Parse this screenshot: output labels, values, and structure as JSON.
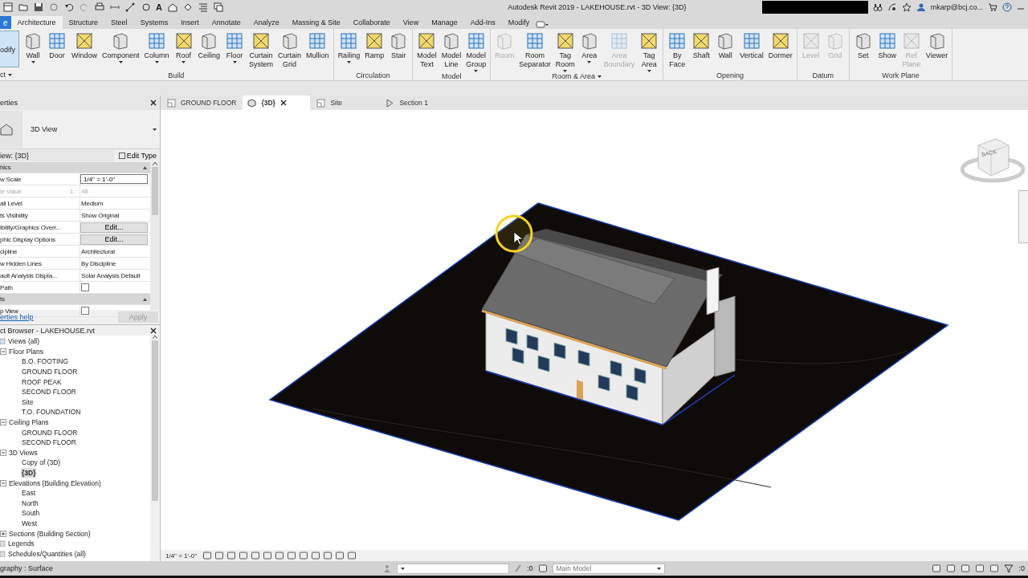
{
  "title_bar": {
    "title": "Autodesk Revit 2019 - LAKEHOUSE.rvt - 3D View: {3D}",
    "text_tool": "A",
    "user": "mkarp@bcj.co..."
  },
  "ribbon": {
    "file_tab": "e",
    "modify_label": "odify",
    "select_label": "ct",
    "tabs": [
      {
        "label": "Architecture",
        "selected": true
      },
      {
        "label": "Structure",
        "selected": false
      },
      {
        "label": "Steel",
        "selected": false
      },
      {
        "label": "Systems",
        "selected": false
      },
      {
        "label": "Insert",
        "selected": false
      },
      {
        "label": "Annotate",
        "selected": false
      },
      {
        "label": "Analyze",
        "selected": false
      },
      {
        "label": "Massing & Site",
        "selected": false
      },
      {
        "label": "Collaborate",
        "selected": false
      },
      {
        "label": "View",
        "selected": false
      },
      {
        "label": "Manage",
        "selected": false
      },
      {
        "label": "Add-Ins",
        "selected": false
      },
      {
        "label": "Modify",
        "selected": false
      }
    ],
    "groups": [
      {
        "label": "Build",
        "dropdown": false,
        "tools": [
          {
            "label": "Wall",
            "disabled": false,
            "dropdown": true
          },
          {
            "label": "Door",
            "disabled": false,
            "dropdown": false
          },
          {
            "label": "Window",
            "disabled": false,
            "dropdown": false
          },
          {
            "label": "Component",
            "disabled": false,
            "dropdown": true
          },
          {
            "label": "Column",
            "disabled": false,
            "dropdown": true
          },
          {
            "label": "Roof",
            "disabled": false,
            "dropdown": true
          },
          {
            "label": "Ceiling",
            "disabled": false,
            "dropdown": false
          },
          {
            "label": "Floor",
            "disabled": false,
            "dropdown": true
          },
          {
            "label": "Curtain System",
            "disabled": false,
            "dropdown": false
          },
          {
            "label": "Curtain Grid",
            "disabled": false,
            "dropdown": false
          },
          {
            "label": "Mullion",
            "disabled": false,
            "dropdown": false
          }
        ]
      },
      {
        "label": "Circulation",
        "dropdown": false,
        "tools": [
          {
            "label": "Railing",
            "disabled": false,
            "dropdown": true
          },
          {
            "label": "Ramp",
            "disabled": false,
            "dropdown": false
          },
          {
            "label": "Stair",
            "disabled": false,
            "dropdown": false
          }
        ]
      },
      {
        "label": "Model",
        "dropdown": false,
        "tools": [
          {
            "label": "Model Text",
            "disabled": false,
            "dropdown": false
          },
          {
            "label": "Model Line",
            "disabled": false,
            "dropdown": false
          },
          {
            "label": "Model Group",
            "disabled": false,
            "dropdown": true
          }
        ]
      },
      {
        "label": "Room & Area",
        "dropdown": true,
        "tools": [
          {
            "label": "Room",
            "disabled": true,
            "dropdown": false
          },
          {
            "label": "Room Separator",
            "disabled": false,
            "dropdown": false
          },
          {
            "label": "Tag Room",
            "disabled": false,
            "dropdown": true
          },
          {
            "label": "Area",
            "disabled": false,
            "dropdown": true
          },
          {
            "label": "Area Boundary",
            "disabled": true,
            "dropdown": false
          },
          {
            "label": "Tag Area",
            "disabled": false,
            "dropdown": true
          }
        ]
      },
      {
        "label": "Opening",
        "dropdown": false,
        "tools": [
          {
            "label": "By Face",
            "disabled": false,
            "dropdown": false
          },
          {
            "label": "Shaft",
            "disabled": false,
            "dropdown": false
          },
          {
            "label": "Wall",
            "disabled": false,
            "dropdown": false
          },
          {
            "label": "Vertical",
            "disabled": false,
            "dropdown": false
          },
          {
            "label": "Dormer",
            "disabled": false,
            "dropdown": false
          }
        ]
      },
      {
        "label": "Datum",
        "dropdown": false,
        "tools": [
          {
            "label": "Level",
            "disabled": true,
            "dropdown": false
          },
          {
            "label": "Grid",
            "disabled": true,
            "dropdown": false
          }
        ]
      },
      {
        "label": "Work Plane",
        "dropdown": false,
        "tools": [
          {
            "label": "Set",
            "disabled": false,
            "dropdown": false
          },
          {
            "label": "Show",
            "disabled": false,
            "dropdown": false
          },
          {
            "label": "Ref Plane",
            "disabled": true,
            "dropdown": false
          },
          {
            "label": "Viewer",
            "disabled": false,
            "dropdown": false
          }
        ]
      }
    ]
  },
  "properties": {
    "title": "erties",
    "type_name": "3D View",
    "instance": "iew: {3D}",
    "edit_type": "Edit Type",
    "help": "erties help",
    "apply": "Apply",
    "rows": [
      {
        "kind": "section",
        "label": "hics"
      },
      {
        "kind": "field",
        "label": "w Scale",
        "value": "1/4\" = 1'-0\""
      },
      {
        "kind": "readonly",
        "label": "le Value",
        "suffix": "1:",
        "value": "48"
      },
      {
        "kind": "text",
        "label": "ail Level",
        "value": "Medium"
      },
      {
        "kind": "text",
        "label": "ts Visibility",
        "value": "Show Original"
      },
      {
        "kind": "button",
        "label": "ibility/Graphics Overr...",
        "value": "Edit..."
      },
      {
        "kind": "button",
        "label": "phic Display Options",
        "value": "Edit..."
      },
      {
        "kind": "text",
        "label": "cipline",
        "value": "Architectural"
      },
      {
        "kind": "text",
        "label": "w Hidden Lines",
        "value": "By Discipline"
      },
      {
        "kind": "text",
        "label": "ault Analysis Displa...",
        "value": "Solar Analysis Default"
      },
      {
        "kind": "checkbox",
        "label": " Path",
        "checked": false
      },
      {
        "kind": "section",
        "label": "ts"
      },
      {
        "kind": "checkbox",
        "label": "p View",
        "checked": false
      }
    ]
  },
  "browser": {
    "title": "ct Browser - LAKEHOUSE.rvt",
    "tree": [
      {
        "label": "Views (all)",
        "selected": false,
        "expanded": true,
        "children": [
          {
            "label": "Floor Plans",
            "selected": false,
            "expanded": true,
            "children": [
              {
                "label": "B.O. FOOTING",
                "selected": false
              },
              {
                "label": "GROUND FLOOR",
                "selected": false
              },
              {
                "label": "ROOF PEAK",
                "selected": false
              },
              {
                "label": "SECOND FLOOR",
                "selected": false
              },
              {
                "label": "Site",
                "selected": false
              },
              {
                "label": "T.O. FOUNDATION",
                "selected": false
              }
            ]
          },
          {
            "label": "Ceiling Plans",
            "selected": false,
            "expanded": true,
            "children": [
              {
                "label": "GROUND FLOOR",
                "selected": false
              },
              {
                "label": "SECOND FLOOR",
                "selected": false
              }
            ]
          },
          {
            "label": "3D Views",
            "selected": false,
            "expanded": true,
            "children": [
              {
                "label": "Copy of (3D)",
                "selected": false
              },
              {
                "label": "{3D}",
                "selected": true
              }
            ]
          },
          {
            "label": "Elevations (Building Elevation)",
            "selected": false,
            "expanded": true,
            "children": [
              {
                "label": "East",
                "selected": false
              },
              {
                "label": "North",
                "selected": false
              },
              {
                "label": "South",
                "selected": false
              },
              {
                "label": "West",
                "selected": false
              }
            ]
          },
          {
            "label": "Sections (Building Section)",
            "selected": false,
            "expanded": false
          }
        ]
      },
      {
        "label": "Legends",
        "selected": false
      },
      {
        "label": "Schedules/Quantities (all)",
        "selected": false
      }
    ]
  },
  "view_tabs": [
    {
      "label": "GROUND FLOOR",
      "kind": "plan",
      "selected": false
    },
    {
      "label": "{3D}",
      "kind": "model",
      "selected": true
    },
    {
      "label": "Site",
      "kind": "plan",
      "selected": false
    },
    {
      "label": "Section 1",
      "kind": "section",
      "selected": false
    }
  ],
  "viewcube": {
    "face": "BACK"
  },
  "view_control": {
    "scale": "1/4\" = 1'-0\""
  },
  "status_bar": {
    "message": "graphy : Surface",
    "workset_count": ":0",
    "model": "Main Model",
    "filter_count": ":0"
  }
}
